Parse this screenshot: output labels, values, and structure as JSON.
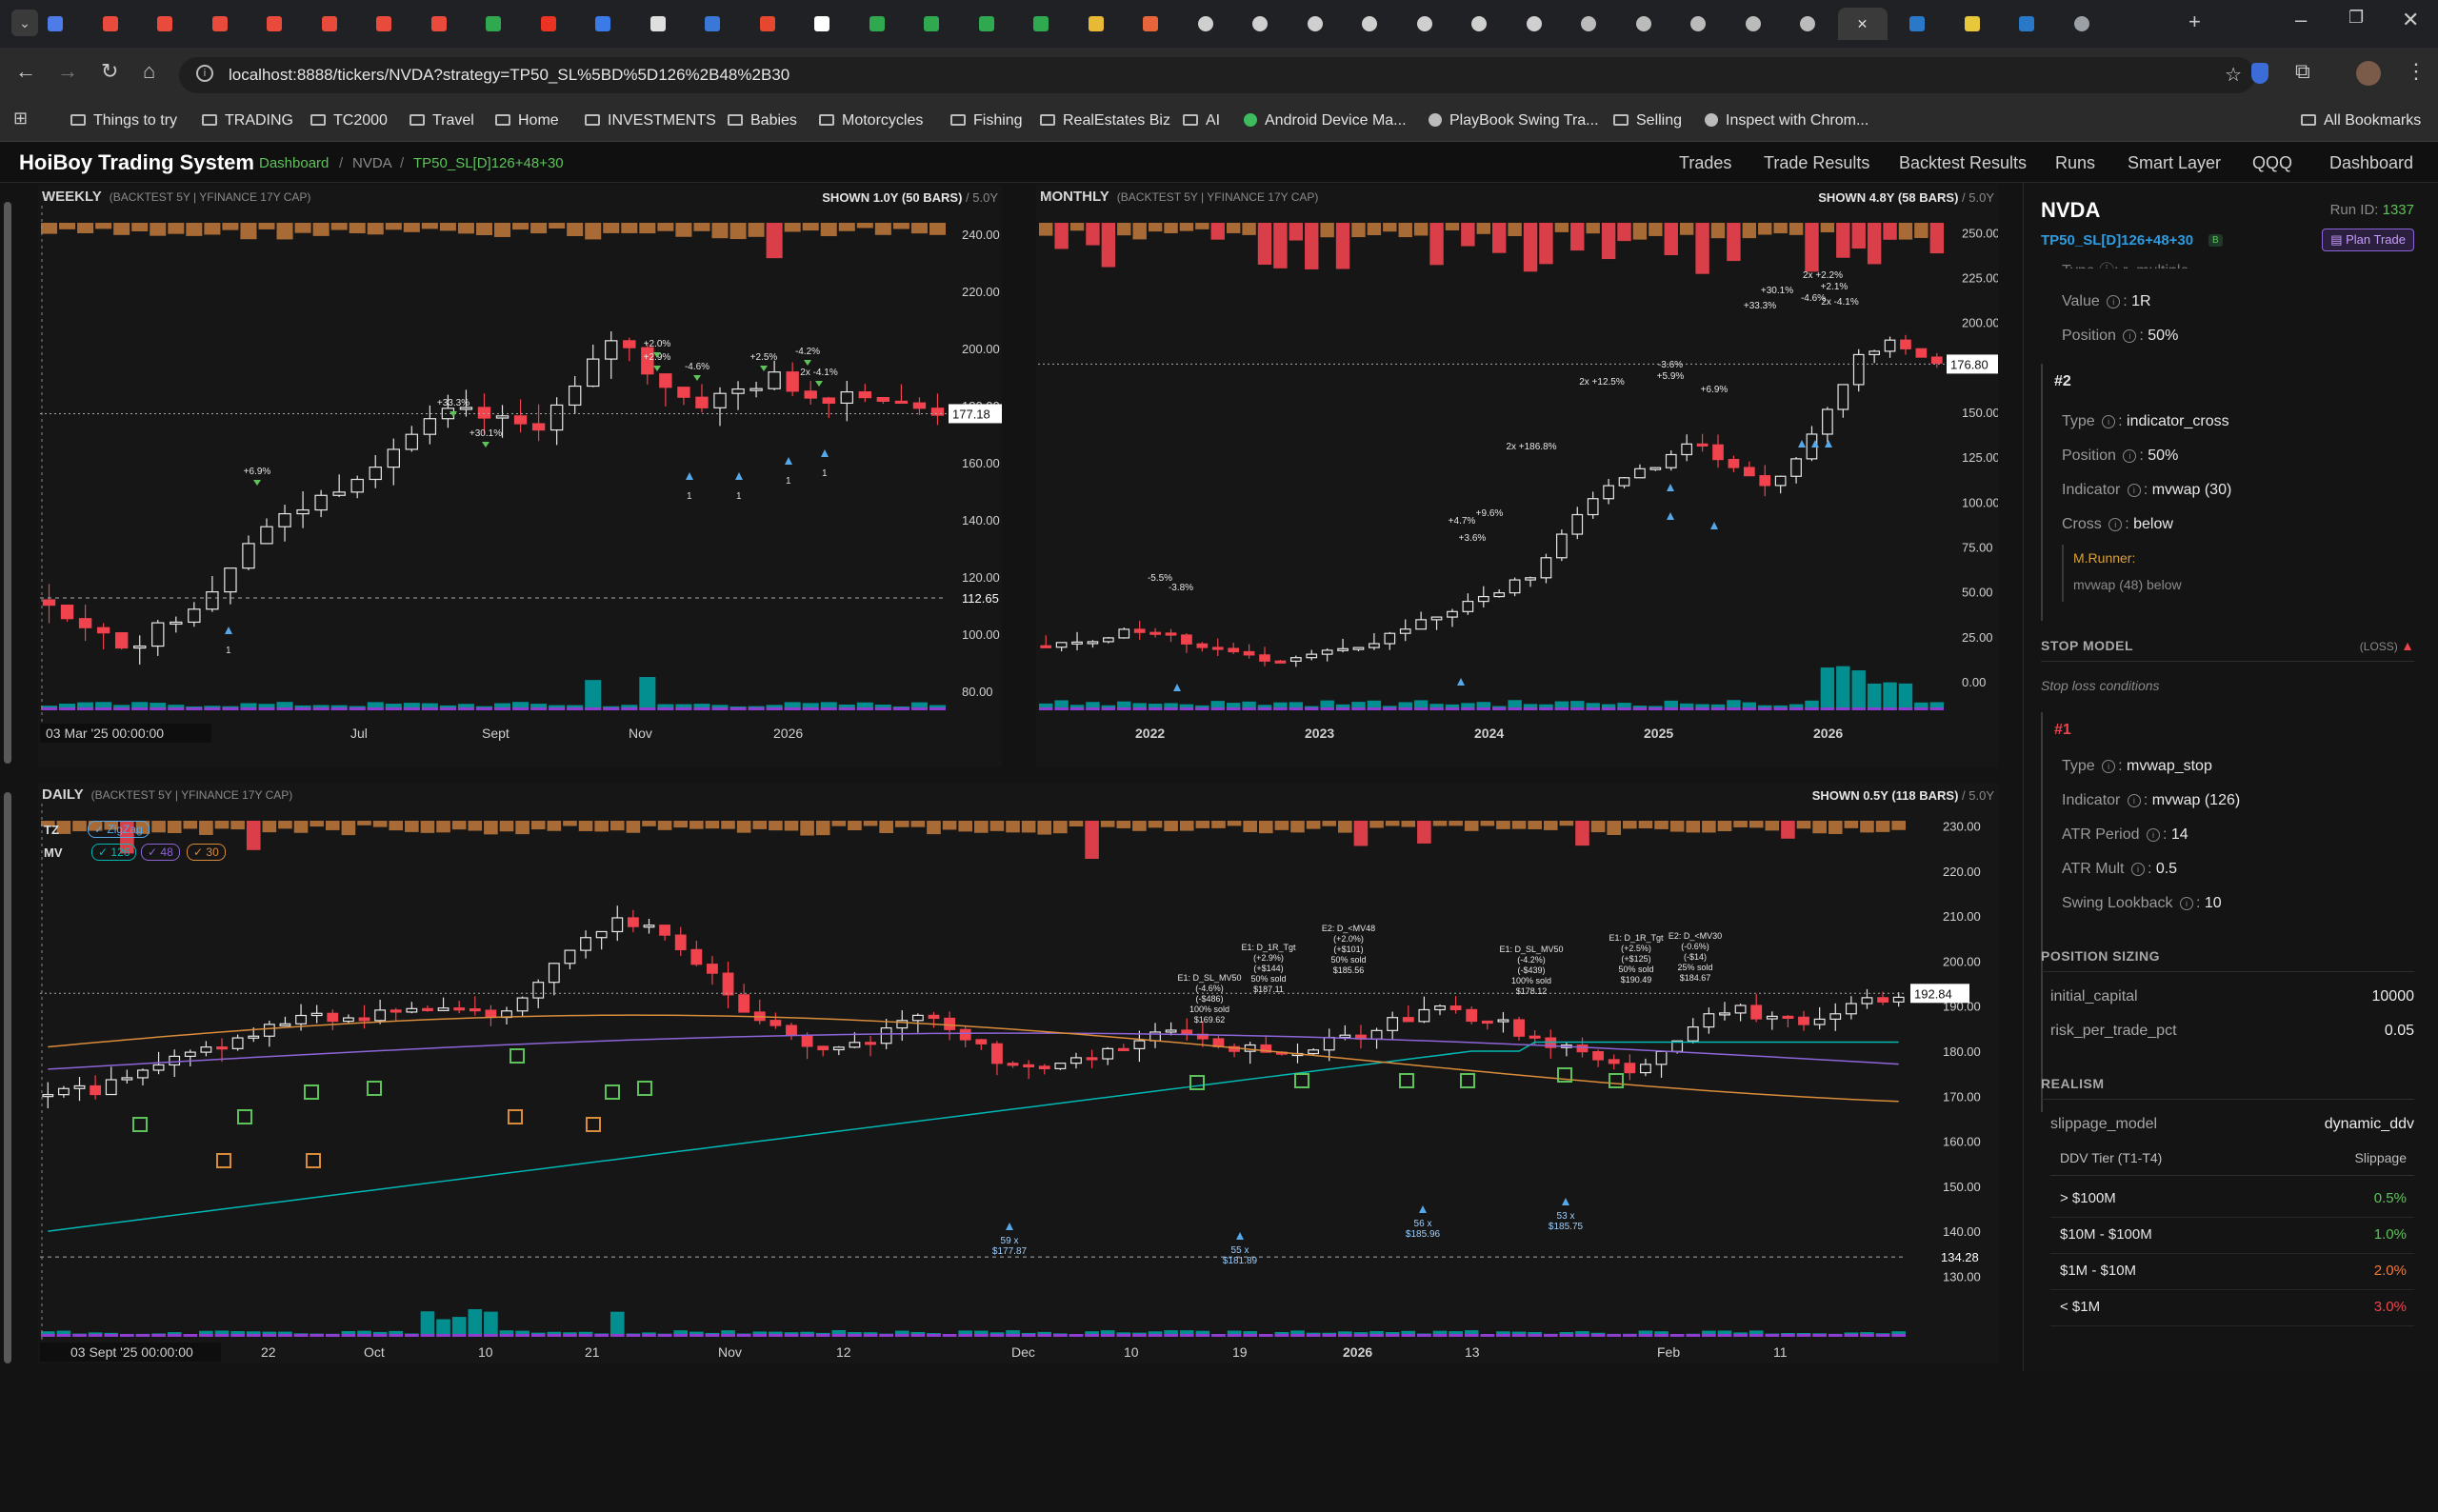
{
  "browser": {
    "url": "localhost:8888/tickers/NVDA?strategy=TP50_SL%5BD%5D126%2B48%2B30",
    "bookmarks": [
      "Things to try",
      "TRADING",
      "TC2000",
      "Travel",
      "Home",
      "INVESTMENTS",
      "Babies",
      "Motorcycles",
      "Fishing",
      "RealEstates Biz",
      "AI",
      "Android Device Ma...",
      "PlayBook Swing Tra...",
      "Selling",
      "Inspect with Chrom..."
    ],
    "all_bookmarks": "All Bookmarks",
    "tab_icons": [
      "gmail-icon",
      "youtube-icon",
      "github-icon",
      "linkedin-icon"
    ]
  },
  "app": {
    "title": "HoiBoy Trading System",
    "breadcrumb": [
      "Dashboard",
      "NVDA",
      "TP50_SL[D]126+48+30"
    ],
    "nav": [
      "Trades",
      "Trade Results",
      "Backtest Results",
      "Runs",
      "Smart Layer",
      "QQQ",
      "Dashboard"
    ],
    "colors": {
      "up": "#e8e8e8",
      "down": "#f0434e",
      "accent": "#00b9b5",
      "orange": "#d98c3a",
      "green": "#5ec25b",
      "purple": "#8e65d8"
    }
  },
  "weekly": {
    "title": "WEEKLY",
    "sub": "(BACKTEST 5Y | YFINANCE 17Y CAP)",
    "shown": "SHOWN 1.0Y (50 BARS)",
    "total": "/ 5.0Y",
    "price_label": "177.18",
    "ref_label": "112.65",
    "y_ticks": [
      "240.00",
      "220.00",
      "200.00",
      "180.00",
      "160.00",
      "140.00",
      "120.00",
      "100.00",
      "80.00"
    ],
    "x_ticks": [
      "03 Mar '25  00:00:00",
      "Jul",
      "Sept",
      "Nov",
      "2026"
    ],
    "annotations": [
      "+6.9%",
      "+30.1%",
      "+33.3%",
      "+2.9%",
      "+2.0%",
      "-4.6%",
      "+2.5%",
      "-4.2%",
      "2x -4.1%"
    ]
  },
  "monthly": {
    "title": "MONTHLY",
    "sub": "(BACKTEST 5Y | YFINANCE 17Y CAP)",
    "shown": "SHOWN 4.8Y (58 BARS)",
    "total": "/ 5.0Y",
    "price_label": "176.80",
    "y_ticks": [
      "250.00",
      "225.00",
      "200.00",
      "175.00",
      "150.00",
      "125.00",
      "100.00",
      "75.00",
      "50.00",
      "25.00",
      "0.00"
    ],
    "x_ticks": [
      "2022",
      "2023",
      "2024",
      "2025",
      "2026"
    ],
    "annotations": [
      "-5.5%",
      "-3.8%",
      "+4.7%",
      "+9.6%",
      "+3.6%",
      "2x +186.8%",
      "2x +12.5%",
      "-3.6%",
      "+5.9%",
      "+6.9%",
      "+30.1%",
      "+33.3%",
      "2x +2.2%",
      "+2.1%",
      "-4.6%",
      "2x -4.1%"
    ]
  },
  "daily": {
    "title": "DAILY",
    "sub": "(BACKTEST 5Y | YFINANCE 17Y CAP)",
    "shown": "SHOWN 0.5Y (118 BARS)",
    "total": "/ 5.0Y",
    "price_label": "192.84",
    "ref_label": "134.28",
    "legend_tz": "TZ",
    "legend_zz": "✓ ZigZag",
    "legend_mv": "MV",
    "legend_mv_items": [
      "✓ 126",
      "✓ 48",
      "✓ 30"
    ],
    "y_ticks": [
      "230.00",
      "220.00",
      "210.00",
      "200.00",
      "190.00",
      "180.00",
      "170.00",
      "160.00",
      "150.00",
      "140.00",
      "130.00"
    ],
    "x_ticks": [
      "03 Sept '25  00:00:00",
      "22",
      "Oct",
      "10",
      "21",
      "Nov",
      "12",
      "Dec",
      "10",
      "19",
      "2026",
      "13",
      "Feb",
      "11"
    ],
    "entries": [
      "59 x\n$177.87",
      "55 x\n$181.89",
      "56 x\n$185.96",
      "53 x\n$185.75"
    ],
    "trade_notes": [
      "E1: D_SL_MV50\n(-4.6%)\n(-$486)\n100% sold\n$169.62",
      "E1: D_1R_Tgt\n(+2.9%)\n(+$144)\n50% sold\n$187.11",
      "E2: D_<MV48\n(+2.0%)\n(+$101)\n50% sold\n$185.56",
      "E1: D_SL_MV50\n(-4.2%)\n(-$439)\n100% sold\n$178.12",
      "E1: D_1R_Tgt\n(+2.5%)\n(+$125)\n50% sold\n$190.49",
      "E2: D_<MV30\n(-0.6%)\n(-$14)\n25% sold\n$184.67"
    ]
  },
  "sidebar": {
    "ticker": "NVDA",
    "run_id_label": "Run ID:",
    "run_id": "1337",
    "strategy": "TP50_SL[D]126+48+30",
    "badge": "B",
    "plan_trade": "Plan Trade",
    "partial_top": "Type  ⓘ: r_multiple",
    "exit1": {
      "value_k": "Value",
      "value_v": "1R",
      "pos_k": "Position",
      "pos_v": "50%"
    },
    "exit2": {
      "num": "#2",
      "type_k": "Type",
      "type_v": "indicator_cross",
      "pos_k": "Position",
      "pos_v": "50%",
      "ind_k": "Indicator",
      "ind_v": "mvwap (30)",
      "cross_k": "Cross",
      "cross_v": "below",
      "runner": "M.Runner:",
      "runner_v": "mvwap (48) below"
    },
    "stop": {
      "title": "STOP MODEL",
      "tag": "(LOSS)",
      "desc": "Stop loss conditions",
      "num": "#1",
      "type_k": "Type",
      "type_v": "mvwap_stop",
      "ind_k": "Indicator",
      "ind_v": "mvwap (126)",
      "atrp_k": "ATR Period",
      "atrp_v": "14",
      "atrm_k": "ATR Mult",
      "atrm_v": "0.5",
      "swing_k": "Swing Lookback",
      "swing_v": "10"
    },
    "sizing": {
      "title": "POSITION SIZING",
      "cap_k": "initial_capital",
      "cap_v": "10000",
      "risk_k": "risk_per_trade_pct",
      "risk_v": "0.05"
    },
    "realism": {
      "title": "REALISM",
      "slip_k": "slippage_model",
      "slip_v": "dynamic_ddv",
      "tier_h": "DDV Tier (T1-T4)",
      "slip_h": "Slippage",
      "tiers": [
        {
          "tier": "> $100M",
          "slip": "0.5%",
          "color": "#5ec25b"
        },
        {
          "tier": "$10M - $100M",
          "slip": "1.0%",
          "color": "#5ec25b"
        },
        {
          "tier": "$1M - $10M",
          "slip": "2.0%",
          "color": "#f07a3a"
        },
        {
          "tier": "< $1M",
          "slip": "3.0%",
          "color": "#f0434e"
        }
      ]
    }
  }
}
